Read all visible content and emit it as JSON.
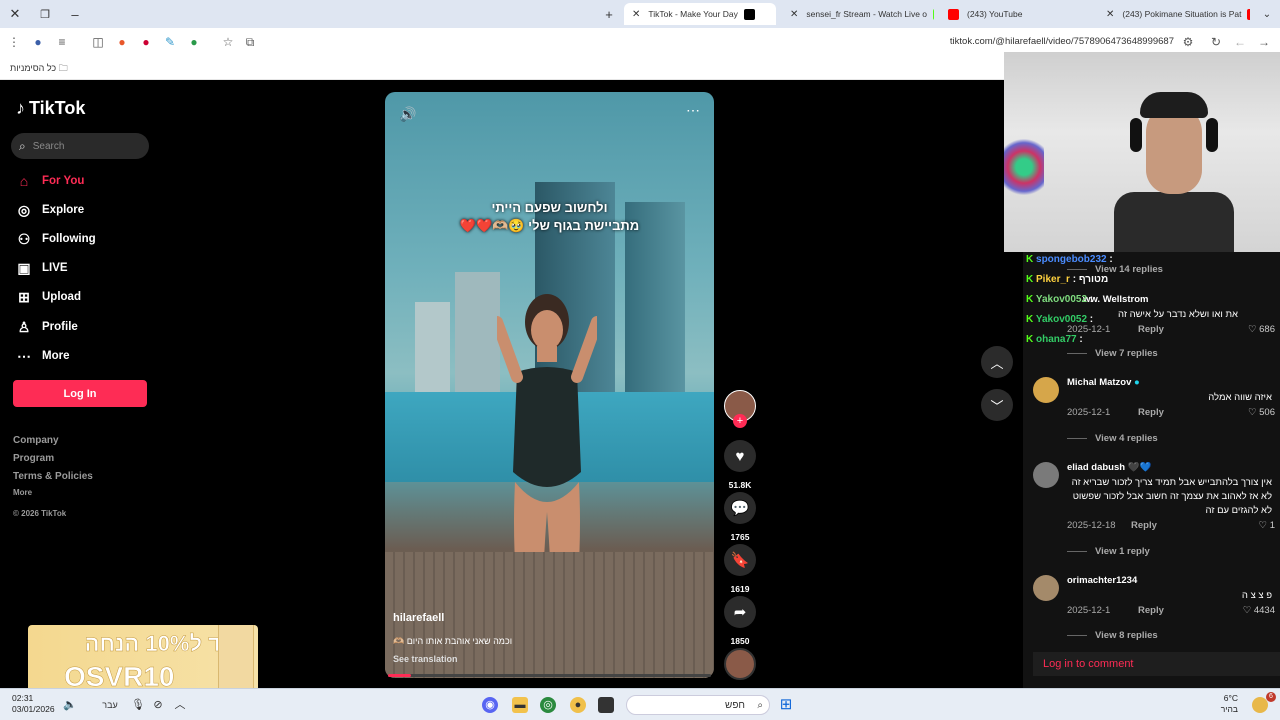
{
  "browser": {
    "tabs": [
      {
        "title": "TikTok - Make Your Day",
        "active": true
      },
      {
        "title": "sensei_fr Stream - Watch Live o",
        "active": false
      },
      {
        "title": "(243) YouTube",
        "active": false
      },
      {
        "title": "(243) Pokimane Situation is Pat",
        "active": false
      }
    ],
    "url": "tiktok.com/@hilarefaell/video/7578906473648999687",
    "bookmarks_label": "כל הסימניות"
  },
  "sidebar": {
    "logo": "TikTok",
    "search_placeholder": "Search",
    "nav": [
      {
        "label": "For You",
        "icon": "home-icon",
        "active": true
      },
      {
        "label": "Explore",
        "icon": "compass-icon"
      },
      {
        "label": "Following",
        "icon": "following-icon"
      },
      {
        "label": "LIVE",
        "icon": "live-icon"
      },
      {
        "label": "Upload",
        "icon": "upload-icon"
      },
      {
        "label": "Profile",
        "icon": "profile-icon"
      },
      {
        "label": "More",
        "icon": "more-icon"
      }
    ],
    "login_label": "Log In",
    "footer": {
      "company": "Company",
      "program": "Program",
      "terms": "Terms & Policies",
      "more": "More",
      "copyright": "© 2026 TikTok"
    }
  },
  "promo": {
    "line1": "קוד ל10% הנחה",
    "line2": "OSVR10"
  },
  "video": {
    "overlay_line1": "ולחשוב שפעם הייתי",
    "overlay_line2": "מתביישת בגוף שלי 🥹🫶🏼❤️❤️",
    "author": "hilarefaell",
    "caption": "וכמה שאני אוהבת אותו היום 🫶🏼",
    "see_translation": "See translation",
    "progress": 0.07
  },
  "actions": {
    "likes": "51.8K",
    "comments": "1765",
    "saves": "1619",
    "shares": "1850"
  },
  "chat": [
    {
      "user": "spongebob232",
      "text": ":",
      "color": "#4a8cff"
    },
    {
      "user": "Piker_r",
      "text": ": מטורף",
      "color": "#ffd23f"
    },
    {
      "user": "Yakov0052",
      "text": ":",
      "color": "#7fdc7f"
    },
    {
      "user": "ohana77",
      "text": ":",
      "color": "#33cc66"
    }
  ],
  "comments": {
    "top_view_replies": "View 14 replies",
    "partial": {
      "name": "ww. Wellstrom",
      "text": "את ואו ושלא נדבר על אישה זה",
      "date": "2025-12-1",
      "reply": "Reply",
      "likes": "686",
      "view_replies": "View 7 replies"
    },
    "items": [
      {
        "name": "Michal Matzov",
        "text": "איזה שווה אמלה",
        "date": "2025-12-1",
        "reply": "Reply",
        "likes": "506",
        "view_replies": "View 4 replies"
      },
      {
        "name": "eliad dabush",
        "text": "אין צורך בלהתבייש אבל תמיד צריך לזכור שבריא זה לא אז לאהוב את עצמך זה חשוב אבל לזכור שפשוט לא להגזים עם זה",
        "date": "2025-12-18",
        "reply": "Reply",
        "likes": "1",
        "view_replies": "View 1 reply"
      },
      {
        "name": "orimachter1234",
        "text": "פ צ צ ה",
        "date": "2025-12-1",
        "reply": "Reply",
        "likes": "4434",
        "view_replies": "View 8 replies"
      }
    ],
    "login_to_comment": "Log in to comment"
  },
  "taskbar": {
    "time": "02:31",
    "date": "03/01/2026",
    "lang": "עבר",
    "search": "חפש",
    "weather_temp": "6°C",
    "weather_desc": "בהיר",
    "notif": "6"
  },
  "colors": {
    "accent": "#fe2c55",
    "tabbar": "#dfe6f2"
  }
}
